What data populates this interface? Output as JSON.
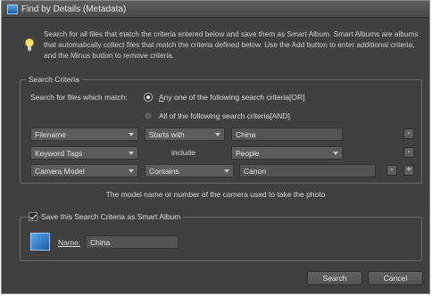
{
  "window": {
    "title": "Find by Details (Metadata)"
  },
  "info": {
    "text": "Search for all files that match the criteria entered below and save them as Smart Album. Smart Albums are albums that automatically collect files that match the criteria defined below. Use the Add button to enter additional criteria, and the Minus button to remove criteria."
  },
  "search_criteria": {
    "group_label": "Search Criteria",
    "match_label": "Search for files which match:",
    "options": [
      {
        "prefix": "A",
        "rest": "ny one of the following search criteria[OR]",
        "selected": true
      },
      {
        "prefix": "",
        "rest": "All of the following search criteria[AND]",
        "selected": false
      }
    ],
    "rows": [
      {
        "field": "Filename",
        "operator": "Starts with",
        "operator_is_dropdown": true,
        "value": "China",
        "value_is_dropdown": false,
        "minus": "-",
        "plus": ""
      },
      {
        "field": "Keyword Tags",
        "operator": "include",
        "operator_is_dropdown": false,
        "value": "People",
        "value_is_dropdown": true,
        "minus": "-",
        "plus": ""
      },
      {
        "field": "Camera Model",
        "operator": "Contains",
        "operator_is_dropdown": true,
        "value": "Canon",
        "value_is_dropdown": false,
        "minus": "-",
        "plus": "+"
      }
    ]
  },
  "caption": "The model name or number of the camera used to take the photo",
  "smart_album": {
    "checkbox_label": "Save this Search Criteria as Smart Album",
    "checked": true,
    "name_label": "Name:",
    "name_value": "China"
  },
  "buttons": {
    "search": "Search",
    "cancel": "Cancel"
  },
  "colors": {
    "background": "#404040",
    "accent": "#1d5fa8"
  },
  "icons": [
    "app-icon",
    "lightbulb-icon",
    "smart-album-icon",
    "dropdown-arrow-icon"
  ]
}
